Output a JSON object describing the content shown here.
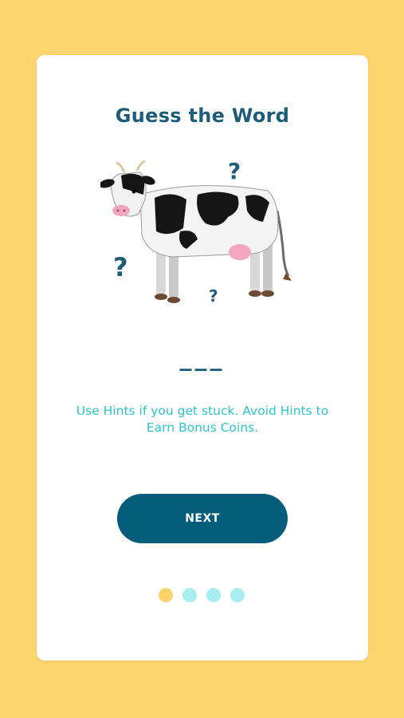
{
  "onboarding": {
    "title": "Guess the Word",
    "blanks": "___",
    "hint_text": "Use Hints if you get stuck. Avoid Hints to Earn Bonus Coins.",
    "next_label": "NEXT",
    "pagination": {
      "total": 4,
      "current": 1
    }
  },
  "illustration": {
    "subject_icon": "cow-icon",
    "question_mark": "?"
  },
  "colors": {
    "background": "#FDD56E",
    "card": "#FFFFFF",
    "title": "#1E5C78",
    "hint": "#2FC3CD",
    "button": "#035C7A",
    "dot_active": "#FCD36B",
    "dot_inactive": "#A7EEF0"
  }
}
